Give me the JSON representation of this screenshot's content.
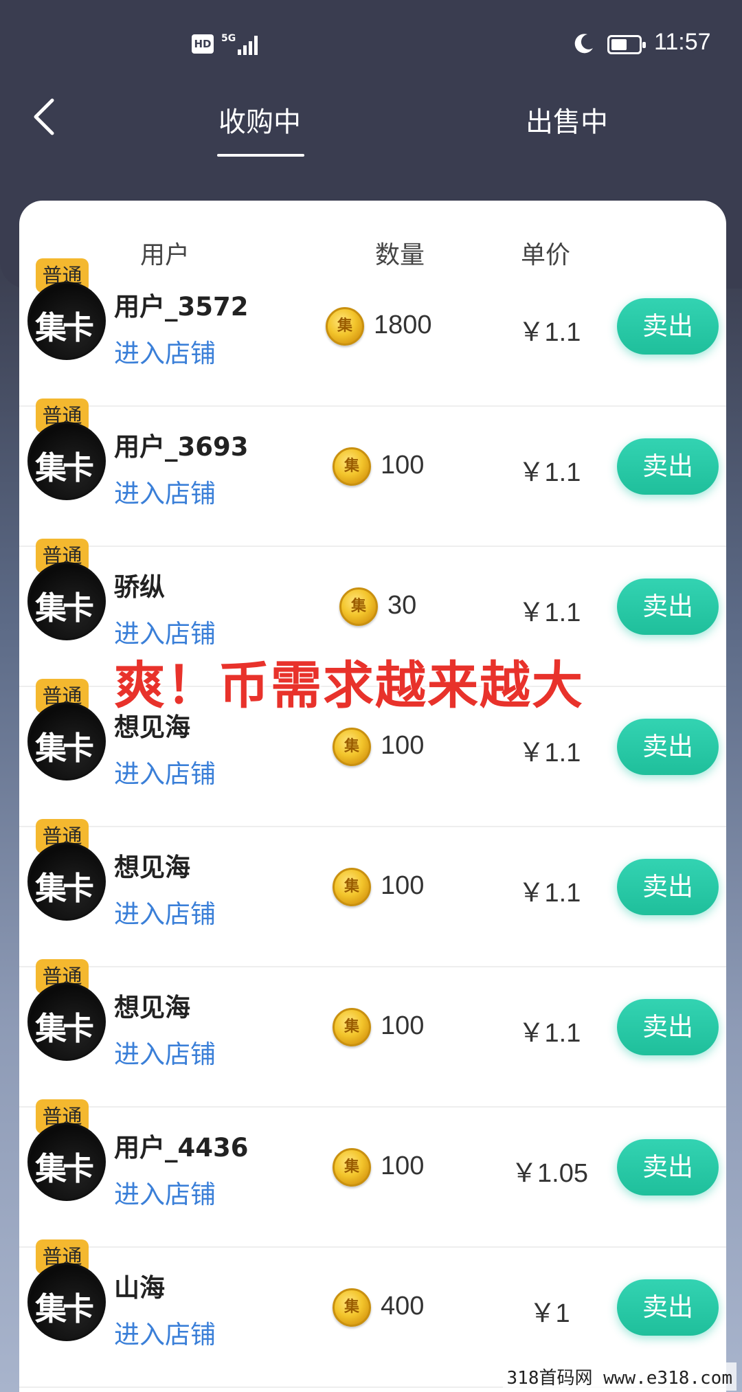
{
  "status_bar": {
    "hd": "HD",
    "network": "5G",
    "time": "11:57"
  },
  "nav": {
    "tabs": [
      {
        "label": "收购中",
        "active": true
      },
      {
        "label": "出售中",
        "active": false
      }
    ]
  },
  "table": {
    "headers": {
      "user": "用户",
      "quantity": "数量",
      "price": "单价"
    },
    "rows": [
      {
        "badge": "普通",
        "avatar_text": "集卡",
        "name": "用户_3572",
        "shop_link": "进入店铺",
        "quantity": "1800",
        "price": "￥1.1",
        "action": "卖出"
      },
      {
        "badge": "普通",
        "avatar_text": "集卡",
        "name": "用户_3693",
        "shop_link": "进入店铺",
        "quantity": "100",
        "price": "￥1.1",
        "action": "卖出"
      },
      {
        "badge": "普通",
        "avatar_text": "集卡",
        "name": "骄纵",
        "shop_link": "进入店铺",
        "quantity": "30",
        "price": "￥1.1",
        "action": "卖出"
      },
      {
        "badge": "普通",
        "avatar_text": "集卡",
        "name": "想见海",
        "shop_link": "进入店铺",
        "quantity": "100",
        "price": "￥1.1",
        "action": "卖出"
      },
      {
        "badge": "普通",
        "avatar_text": "集卡",
        "name": "想见海",
        "shop_link": "进入店铺",
        "quantity": "100",
        "price": "￥1.1",
        "action": "卖出"
      },
      {
        "badge": "普通",
        "avatar_text": "集卡",
        "name": "想见海",
        "shop_link": "进入店铺",
        "quantity": "100",
        "price": "￥1.1",
        "action": "卖出"
      },
      {
        "badge": "普通",
        "avatar_text": "集卡",
        "name": "用户_4436",
        "shop_link": "进入店铺",
        "quantity": "100",
        "price": "￥1.05",
        "action": "卖出"
      },
      {
        "badge": "普通",
        "avatar_text": "集卡",
        "name": "山海",
        "shop_link": "进入店铺",
        "quantity": "400",
        "price": "￥1",
        "action": "卖出"
      }
    ]
  },
  "coin_glyph": "集",
  "overlay_caption": "爽！币需求越来越大",
  "watermark": "318首码网  www.e318.com",
  "colors": {
    "header_bg": "#3a3d50",
    "sell_button": "#22c4a0",
    "shop_link": "#3a7fd8",
    "badge": "#f4b82f",
    "overlay_text": "#e8322b"
  }
}
